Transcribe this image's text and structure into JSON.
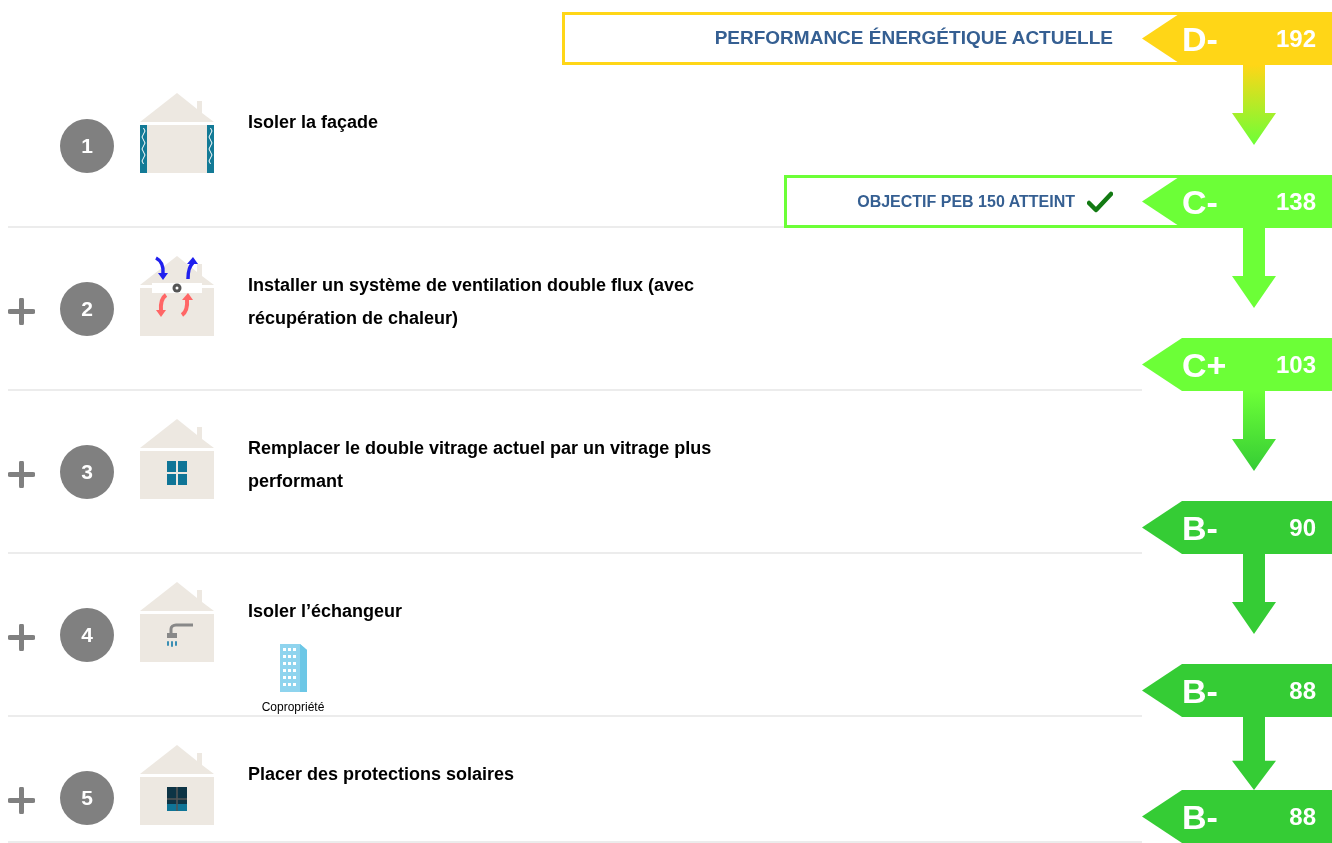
{
  "levels": [
    {
      "grade": "D-",
      "value": "192",
      "color": "#ffd617",
      "banner": {
        "text": "PERFORMANCE ÉNERGÉTIQUE ACTUELLE",
        "achieved": false
      }
    },
    {
      "grade": "C-",
      "value": "138",
      "color": "#6cff37",
      "banner": {
        "text": "OBJECTIF PEB 150 ATTEINT",
        "achieved": true
      }
    },
    {
      "grade": "C+",
      "value": "103",
      "color": "#6cff37"
    },
    {
      "grade": "B-",
      "value": "90",
      "color": "#35cc35"
    },
    {
      "grade": "B-",
      "value": "88",
      "color": "#35cc35"
    },
    {
      "grade": "B-",
      "value": "88",
      "color": "#35cc35"
    }
  ],
  "steps": [
    {
      "number": "1",
      "title": "Isoler la façade",
      "additional": false,
      "kind": "insulation"
    },
    {
      "number": "2",
      "title": "Installer un système de ventilation double flux (avec récupération de chaleur)",
      "additional": true,
      "kind": "ventilation"
    },
    {
      "number": "3",
      "title": "Remplacer le double vitrage actuel par un vitrage plus performant",
      "additional": true,
      "kind": "window"
    },
    {
      "number": "4",
      "title": "Isoler l’échangeur",
      "additional": true,
      "kind": "shower",
      "tag": "Copropriété"
    },
    {
      "number": "5",
      "title": "Placer des protections solaires",
      "additional": true,
      "kind": "shutter"
    }
  ]
}
